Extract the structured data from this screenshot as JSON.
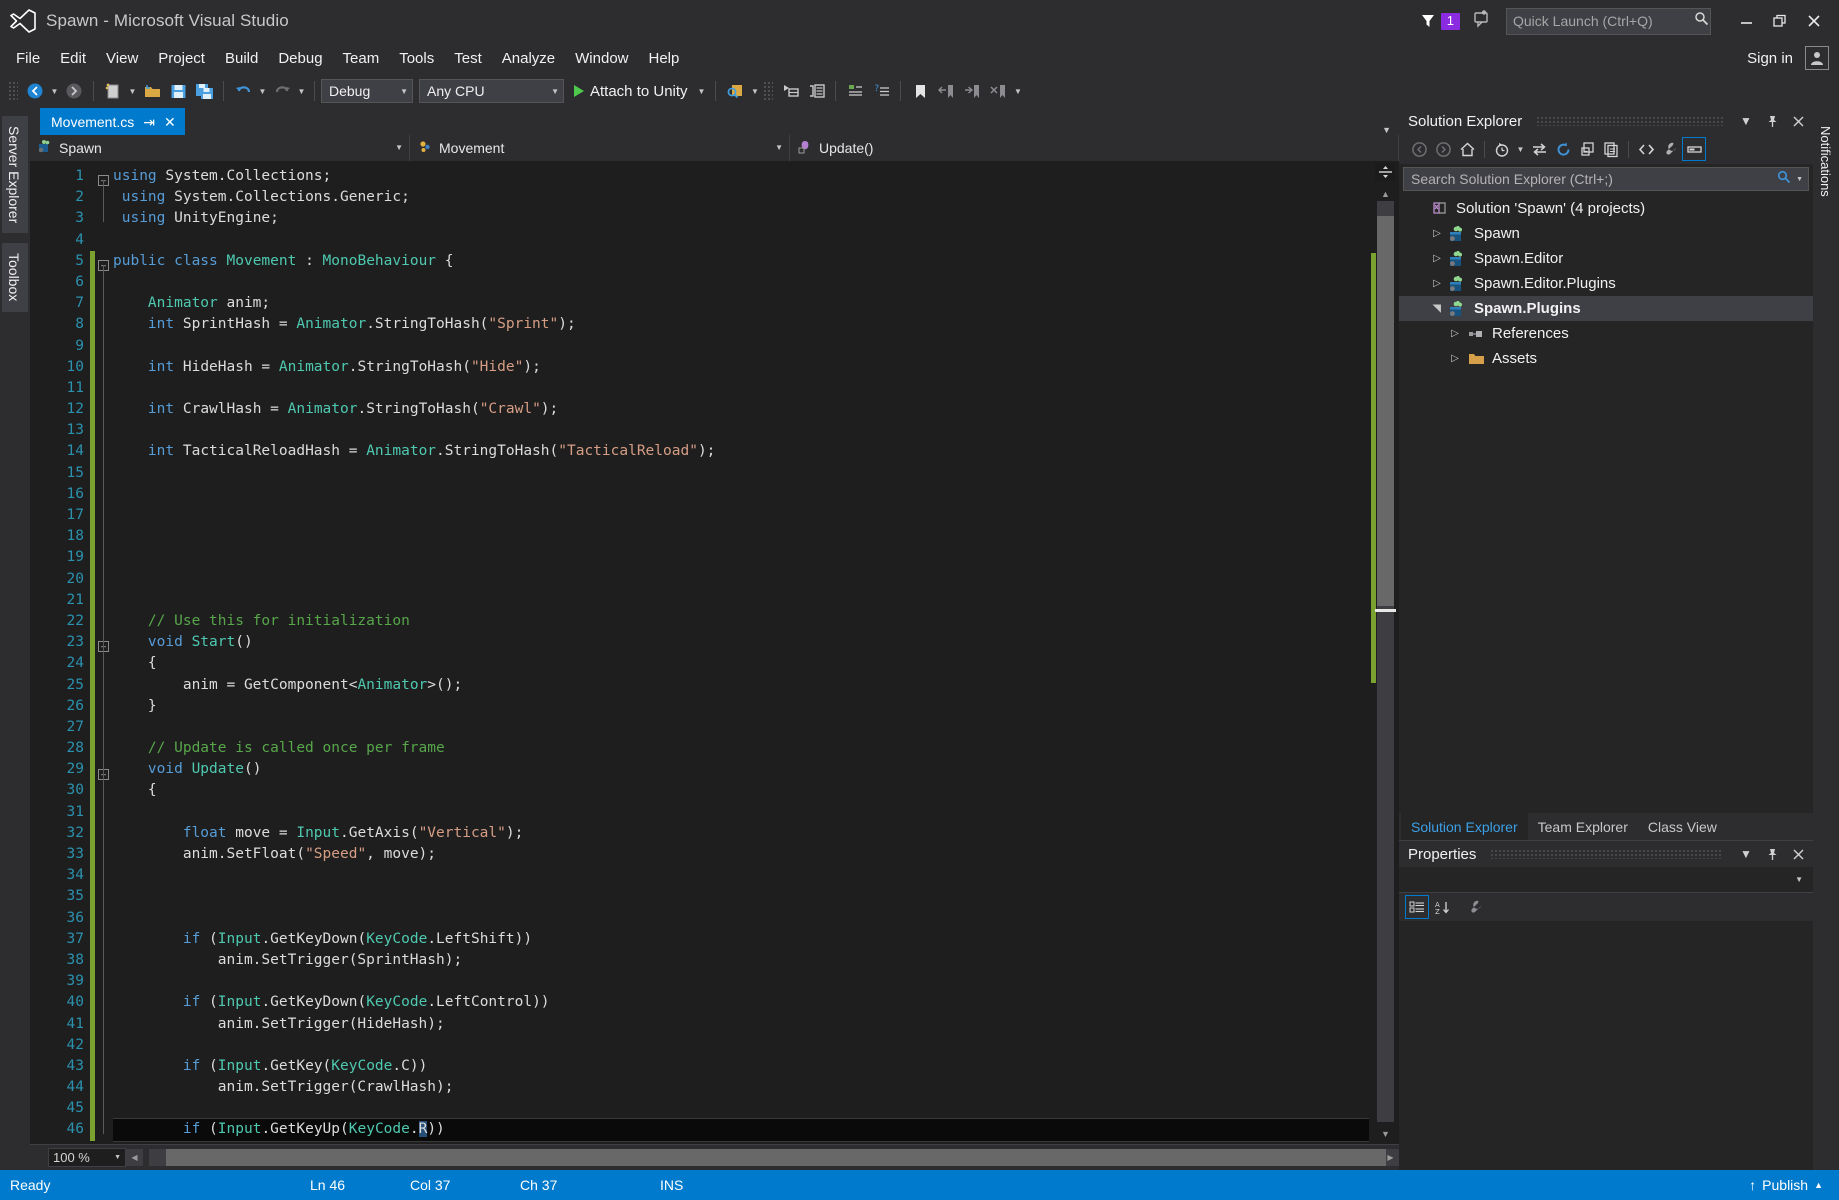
{
  "window": {
    "title": "Spawn - Microsoft Visual Studio",
    "minimize": "—",
    "restore": "❐",
    "close": "✕"
  },
  "notifications": {
    "count": "1"
  },
  "quick_launch": {
    "placeholder": "Quick Launch (Ctrl+Q)",
    "value": ""
  },
  "account": {
    "signin_label": "Sign in"
  },
  "menu": {
    "items": [
      "File",
      "Edit",
      "View",
      "Project",
      "Build",
      "Debug",
      "Team",
      "Tools",
      "Test",
      "Analyze",
      "Window",
      "Help"
    ]
  },
  "toolbar": {
    "config": "Debug",
    "platform": "Any CPU",
    "attach_label": "Attach to Unity",
    "icons": [
      "navigate-back-icon",
      "navigate-forward-icon",
      "new-project-icon",
      "open-file-icon",
      "save-icon",
      "save-all-icon",
      "undo-icon",
      "redo-icon",
      "play-icon",
      "find-in-files-icon",
      "step-into-icon",
      "step-over-icon",
      "comment-icon",
      "uncomment-icon",
      "bookmark-icon",
      "previous-bookmark-icon",
      "next-bookmark-icon",
      "clear-bookmarks-icon",
      "overflow-icon"
    ]
  },
  "left_dock": {
    "tabs": [
      "Server Explorer",
      "Toolbox"
    ]
  },
  "right_rail": {
    "tabs": [
      "Notifications"
    ]
  },
  "editor": {
    "tab": {
      "filename": "Movement.cs",
      "pin": "⇥",
      "close": "✕"
    },
    "nav": {
      "namespace": "Spawn",
      "type": "Movement",
      "member": "Update()"
    },
    "zoom": "100 %",
    "lines": [
      {
        "n": 1,
        "fold": "minus",
        "tokens": [
          [
            "kw",
            "using"
          ],
          [
            "pln",
            " System.Collections;"
          ]
        ]
      },
      {
        "n": 2,
        "fold": "",
        "tokens": [
          [
            "kw",
            " using"
          ],
          [
            "pln",
            " System.Collections.Generic;"
          ]
        ]
      },
      {
        "n": 3,
        "fold": "",
        "tokens": [
          [
            "kw",
            " using"
          ],
          [
            "pln",
            " UnityEngine;"
          ]
        ]
      },
      {
        "n": 4,
        "fold": "",
        "tokens": []
      },
      {
        "n": 5,
        "fold": "minus",
        "tokens": [
          [
            "kw",
            "public class "
          ],
          [
            "typ",
            "Movement"
          ],
          [
            "pln",
            " : "
          ],
          [
            "typ",
            "MonoBehaviour"
          ],
          [
            "pln",
            " {"
          ]
        ]
      },
      {
        "n": 6,
        "fold": "",
        "tokens": []
      },
      {
        "n": 7,
        "fold": "",
        "tokens": [
          [
            "pln",
            "    "
          ],
          [
            "typ",
            "Animator"
          ],
          [
            "pln",
            " anim;"
          ]
        ]
      },
      {
        "n": 8,
        "fold": "",
        "tokens": [
          [
            "pln",
            "    "
          ],
          [
            "kw",
            "int"
          ],
          [
            "pln",
            " SprintHash = "
          ],
          [
            "typ",
            "Animator"
          ],
          [
            "pln",
            ".StringToHash("
          ],
          [
            "str",
            "\"Sprint\""
          ],
          [
            "pln",
            ");"
          ]
        ]
      },
      {
        "n": 9,
        "fold": "",
        "tokens": []
      },
      {
        "n": 10,
        "fold": "",
        "tokens": [
          [
            "pln",
            "    "
          ],
          [
            "kw",
            "int"
          ],
          [
            "pln",
            " HideHash = "
          ],
          [
            "typ",
            "Animator"
          ],
          [
            "pln",
            ".StringToHash("
          ],
          [
            "str",
            "\"Hide\""
          ],
          [
            "pln",
            ");"
          ]
        ]
      },
      {
        "n": 11,
        "fold": "",
        "tokens": []
      },
      {
        "n": 12,
        "fold": "",
        "tokens": [
          [
            "pln",
            "    "
          ],
          [
            "kw",
            "int"
          ],
          [
            "pln",
            " CrawlHash = "
          ],
          [
            "typ",
            "Animator"
          ],
          [
            "pln",
            ".StringToHash("
          ],
          [
            "str",
            "\"Crawl\""
          ],
          [
            "pln",
            ");"
          ]
        ]
      },
      {
        "n": 13,
        "fold": "",
        "tokens": []
      },
      {
        "n": 14,
        "fold": "",
        "tokens": [
          [
            "pln",
            "    "
          ],
          [
            "kw",
            "int"
          ],
          [
            "pln",
            " TacticalReloadHash = "
          ],
          [
            "typ",
            "Animator"
          ],
          [
            "pln",
            ".StringToHash("
          ],
          [
            "str",
            "\"TacticalReload\""
          ],
          [
            "pln",
            ");"
          ]
        ]
      },
      {
        "n": 15,
        "fold": "",
        "tokens": []
      },
      {
        "n": 16,
        "fold": "",
        "tokens": []
      },
      {
        "n": 17,
        "fold": "",
        "tokens": []
      },
      {
        "n": 18,
        "fold": "",
        "tokens": []
      },
      {
        "n": 19,
        "fold": "",
        "tokens": []
      },
      {
        "n": 20,
        "fold": "",
        "tokens": []
      },
      {
        "n": 21,
        "fold": "",
        "tokens": []
      },
      {
        "n": 22,
        "fold": "",
        "tokens": [
          [
            "cmt",
            "    // Use this for initialization"
          ]
        ]
      },
      {
        "n": 23,
        "fold": "minus",
        "tokens": [
          [
            "pln",
            "    "
          ],
          [
            "kw",
            "void"
          ],
          [
            "pln",
            " "
          ],
          [
            "typ",
            "Start"
          ],
          [
            "pln",
            "()"
          ]
        ]
      },
      {
        "n": 24,
        "fold": "",
        "tokens": [
          [
            "pln",
            "    {"
          ]
        ]
      },
      {
        "n": 25,
        "fold": "",
        "tokens": [
          [
            "pln",
            "        anim = GetComponent<"
          ],
          [
            "typ",
            "Animator"
          ],
          [
            "pln",
            ">();"
          ]
        ]
      },
      {
        "n": 26,
        "fold": "",
        "tokens": [
          [
            "pln",
            "    }"
          ]
        ]
      },
      {
        "n": 27,
        "fold": "",
        "tokens": []
      },
      {
        "n": 28,
        "fold": "",
        "tokens": [
          [
            "cmt",
            "    // Update is called once per frame"
          ]
        ]
      },
      {
        "n": 29,
        "fold": "minus",
        "tokens": [
          [
            "pln",
            "    "
          ],
          [
            "kw",
            "void"
          ],
          [
            "pln",
            " "
          ],
          [
            "typ",
            "Update"
          ],
          [
            "pln",
            "()"
          ]
        ]
      },
      {
        "n": 30,
        "fold": "",
        "tokens": [
          [
            "pln",
            "    {"
          ]
        ]
      },
      {
        "n": 31,
        "fold": "",
        "tokens": []
      },
      {
        "n": 32,
        "fold": "",
        "tokens": [
          [
            "pln",
            "        "
          ],
          [
            "kw",
            "float"
          ],
          [
            "pln",
            " move = "
          ],
          [
            "typ",
            "Input"
          ],
          [
            "pln",
            ".GetAxis("
          ],
          [
            "str",
            "\"Vertical\""
          ],
          [
            "pln",
            ");"
          ]
        ]
      },
      {
        "n": 33,
        "fold": "",
        "tokens": [
          [
            "pln",
            "        anim.SetFloat("
          ],
          [
            "str",
            "\"Speed\""
          ],
          [
            "pln",
            ", move);"
          ]
        ]
      },
      {
        "n": 34,
        "fold": "",
        "tokens": []
      },
      {
        "n": 35,
        "fold": "",
        "tokens": []
      },
      {
        "n": 36,
        "fold": "",
        "tokens": []
      },
      {
        "n": 37,
        "fold": "",
        "tokens": [
          [
            "pln",
            "        "
          ],
          [
            "kw",
            "if"
          ],
          [
            "pln",
            " ("
          ],
          [
            "typ",
            "Input"
          ],
          [
            "pln",
            ".GetKeyDown("
          ],
          [
            "typ",
            "KeyCode"
          ],
          [
            "pln",
            ".LeftShift))"
          ]
        ]
      },
      {
        "n": 38,
        "fold": "",
        "tokens": [
          [
            "pln",
            "            anim.SetTrigger(SprintHash);"
          ]
        ]
      },
      {
        "n": 39,
        "fold": "",
        "tokens": []
      },
      {
        "n": 40,
        "fold": "",
        "tokens": [
          [
            "pln",
            "        "
          ],
          [
            "kw",
            "if"
          ],
          [
            "pln",
            " ("
          ],
          [
            "typ",
            "Input"
          ],
          [
            "pln",
            ".GetKeyDown("
          ],
          [
            "typ",
            "KeyCode"
          ],
          [
            "pln",
            ".LeftControl))"
          ]
        ]
      },
      {
        "n": 41,
        "fold": "",
        "tokens": [
          [
            "pln",
            "            anim.SetTrigger(HideHash);"
          ]
        ]
      },
      {
        "n": 42,
        "fold": "",
        "tokens": []
      },
      {
        "n": 43,
        "fold": "",
        "tokens": [
          [
            "pln",
            "        "
          ],
          [
            "kw",
            "if"
          ],
          [
            "pln",
            " ("
          ],
          [
            "typ",
            "Input"
          ],
          [
            "pln",
            ".GetKey("
          ],
          [
            "typ",
            "KeyCode"
          ],
          [
            "pln",
            ".C))"
          ]
        ]
      },
      {
        "n": 44,
        "fold": "",
        "tokens": [
          [
            "pln",
            "            anim.SetTrigger(CrawlHash);"
          ]
        ]
      },
      {
        "n": 45,
        "fold": "",
        "tokens": []
      },
      {
        "n": 46,
        "fold": "",
        "current": true,
        "tokens": [
          [
            "pln",
            "        "
          ],
          [
            "kw",
            "if"
          ],
          [
            "pln",
            " ("
          ],
          [
            "typ",
            "Input"
          ],
          [
            "pln",
            ".GetKeyUp("
          ],
          [
            "typ",
            "KeyCode"
          ],
          [
            "pln",
            "."
          ],
          [
            "sel",
            "R"
          ],
          [
            "pln",
            "))"
          ]
        ]
      }
    ]
  },
  "solution_explorer": {
    "title": "Solution Explorer",
    "search_placeholder": "Search Solution Explorer (Ctrl+;)",
    "toolbar_icons": [
      "back-icon",
      "forward-icon",
      "home-icon",
      "pending-changes-icon",
      "sync-with-active-document-icon",
      "refresh-icon",
      "collapse-all-icon",
      "show-all-files-icon",
      "view-code-icon",
      "properties-wrench-icon",
      "preview-selected-items-icon"
    ],
    "tree": [
      {
        "label": "Solution 'Spawn' (4 projects)",
        "indent": 0,
        "twisty": "",
        "icon": "solution-icon",
        "selected": false
      },
      {
        "label": "Spawn",
        "indent": 1,
        "twisty": "collapsed",
        "icon": "csharp-project-icon",
        "selected": false
      },
      {
        "label": "Spawn.Editor",
        "indent": 1,
        "twisty": "collapsed",
        "icon": "csharp-project-icon",
        "selected": false
      },
      {
        "label": "Spawn.Editor.Plugins",
        "indent": 1,
        "twisty": "collapsed",
        "icon": "csharp-project-icon",
        "selected": false
      },
      {
        "label": "Spawn.Plugins",
        "indent": 1,
        "twisty": "expanded",
        "icon": "csharp-project-icon",
        "selected": true
      },
      {
        "label": "References",
        "indent": 2,
        "twisty": "collapsed",
        "icon": "references-icon",
        "selected": false
      },
      {
        "label": "Assets",
        "indent": 2,
        "twisty": "collapsed",
        "icon": "folder-icon",
        "selected": false
      }
    ],
    "tabs": [
      {
        "label": "Solution Explorer",
        "active": true
      },
      {
        "label": "Team Explorer",
        "active": false
      },
      {
        "label": "Class View",
        "active": false
      }
    ]
  },
  "properties": {
    "title": "Properties",
    "selected_object": "",
    "toolbar_icons": [
      "categorized-icon",
      "alphabetical-icon",
      "property-pages-icon"
    ]
  },
  "status_bar": {
    "state": "Ready",
    "line": "Ln 46",
    "column": "Col 37",
    "character": "Ch 37",
    "insert_mode": "INS",
    "publish": "Publish"
  },
  "colors": {
    "accent": "#007acc",
    "titlebar_bg": "#2d2d30",
    "editor_bg": "#1e1e1e",
    "panel_bg": "#252526",
    "badge": "#8a2be2",
    "changebar_saved": "#7aa22f",
    "keyword": "#569cd6",
    "type": "#4ec9b0",
    "string": "#d69d85",
    "comment": "#57a64a",
    "linenumber": "#2b91af",
    "selection": "#264f78"
  }
}
